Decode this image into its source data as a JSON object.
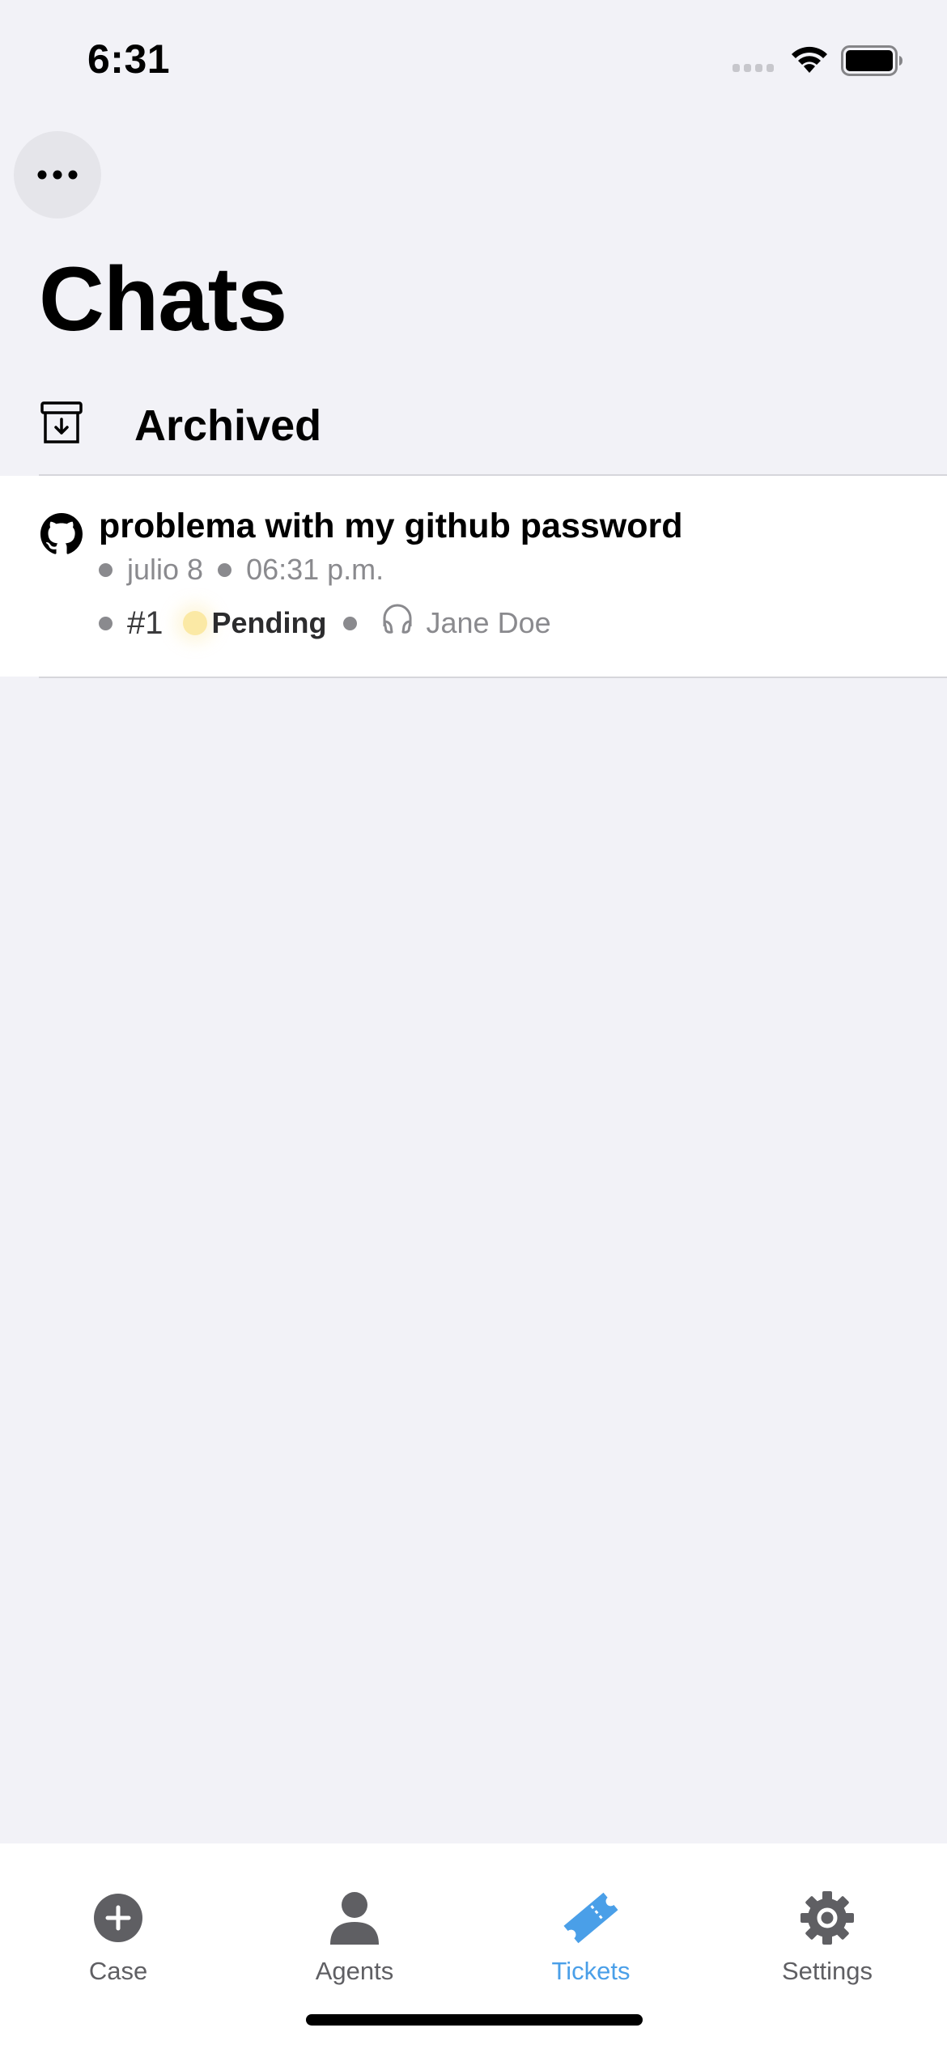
{
  "status_bar": {
    "time": "6:31"
  },
  "header": {
    "more_icon": "ellipsis-icon",
    "title": "Chats"
  },
  "archived": {
    "icon": "archive-box-icon",
    "label": "Archived"
  },
  "chats": [
    {
      "icon": "github-icon",
      "title": "problema with my github password",
      "date": "julio 8",
      "time": "06:31 p.m.",
      "ticket_number": "#1",
      "status": "Pending",
      "status_color": "#fbe9a5",
      "agent_icon": "headset-icon",
      "agent": "Jane Doe"
    }
  ],
  "tab_bar": {
    "active_color": "#4a9fe8",
    "inactive_color": "#5f5f63",
    "tabs": [
      {
        "label": "Case",
        "icon": "plus-circle-icon",
        "active": false
      },
      {
        "label": "Agents",
        "icon": "person-icon",
        "active": false
      },
      {
        "label": "Tickets",
        "icon": "ticket-icon",
        "active": true
      },
      {
        "label": "Settings",
        "icon": "gear-icon",
        "active": false
      }
    ]
  }
}
